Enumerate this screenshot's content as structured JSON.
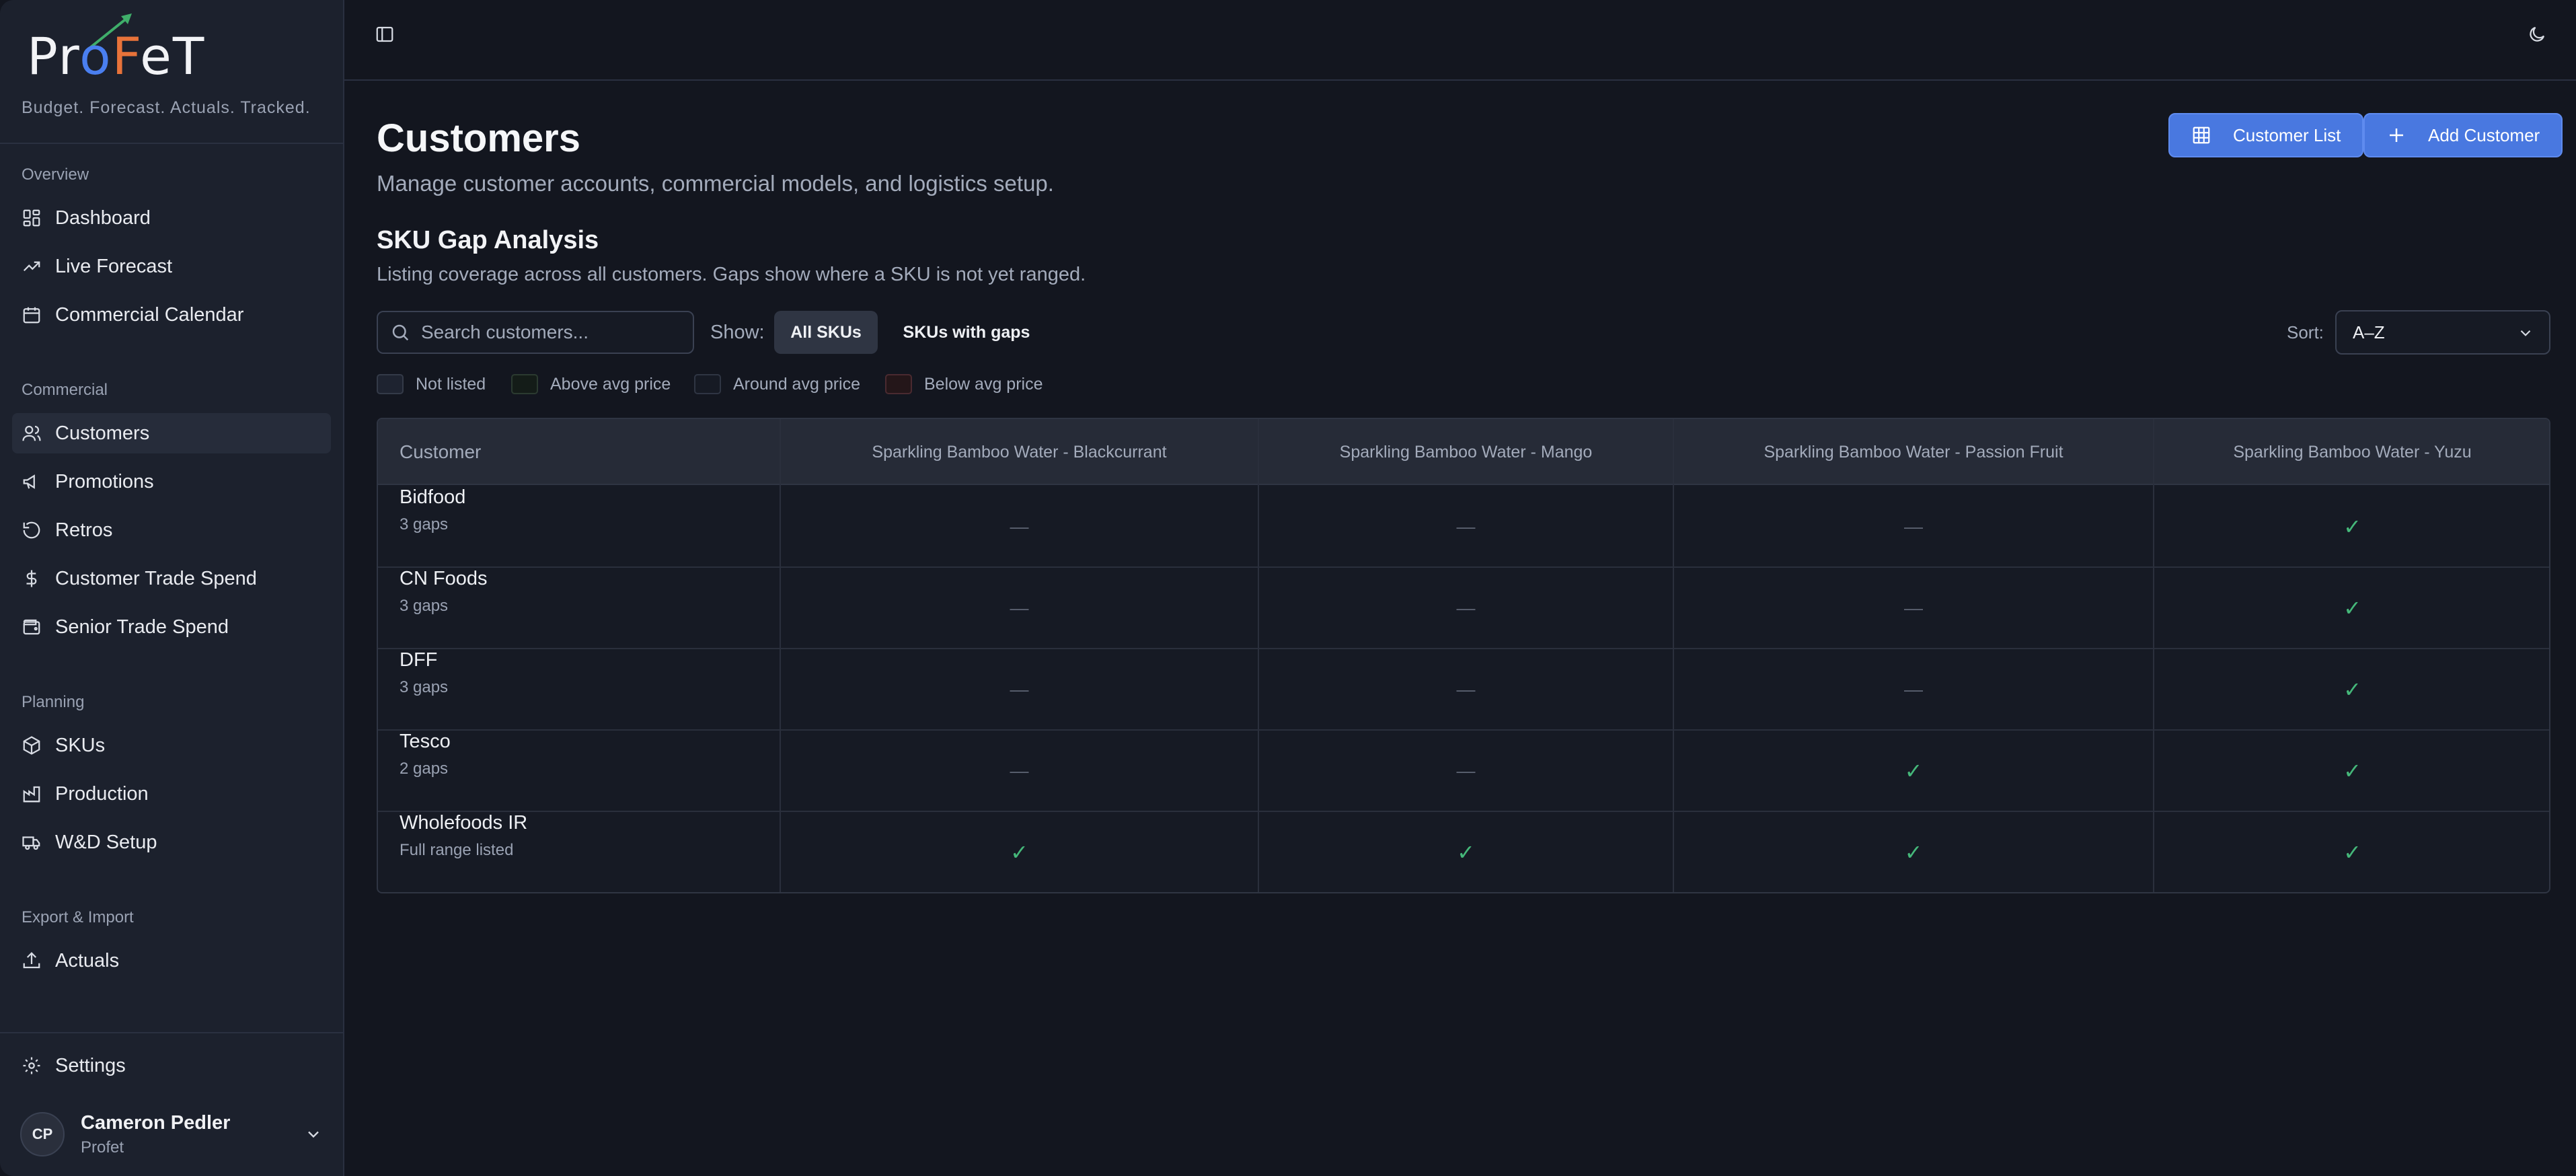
{
  "brand": {
    "logo_text": "ProFeT",
    "tagline": "Budget. Forecast. Actuals. Tracked."
  },
  "sidebar": {
    "groups": [
      {
        "label": "Overview",
        "items": [
          {
            "label": "Dashboard",
            "icon": "dashboard-icon"
          },
          {
            "label": "Live Forecast",
            "icon": "trending-up-icon"
          },
          {
            "label": "Commercial Calendar",
            "icon": "calendar-icon"
          }
        ]
      },
      {
        "label": "Commercial",
        "items": [
          {
            "label": "Customers",
            "icon": "users-icon",
            "active": true
          },
          {
            "label": "Promotions",
            "icon": "megaphone-icon"
          },
          {
            "label": "Retros",
            "icon": "rotate-icon"
          },
          {
            "label": "Customer Trade Spend",
            "icon": "dollar-icon"
          },
          {
            "label": "Senior Trade Spend",
            "icon": "wallet-icon"
          }
        ]
      },
      {
        "label": "Planning",
        "items": [
          {
            "label": "SKUs",
            "icon": "package-icon"
          },
          {
            "label": "Production",
            "icon": "factory-icon"
          },
          {
            "label": "W&D Setup",
            "icon": "truck-icon"
          }
        ]
      },
      {
        "label": "Export & Import",
        "items": [
          {
            "label": "Actuals",
            "icon": "upload-icon"
          }
        ]
      }
    ],
    "settings_label": "Settings",
    "user": {
      "initials": "CP",
      "name": "Cameron Pedler",
      "org": "Profet"
    }
  },
  "header": {
    "title": "Customers",
    "subtitle": "Manage customer accounts, commercial models, and logistics setup.",
    "customer_list_label": "Customer List",
    "add_customer_label": "Add Customer"
  },
  "gap_analysis": {
    "title": "SKU Gap Analysis",
    "subtitle": "Listing coverage across all customers. Gaps show where a SKU is not yet ranged.",
    "search_placeholder": "Search customers...",
    "show_label": "Show:",
    "filters": [
      "All SKUs",
      "SKUs with gaps"
    ],
    "active_filter": "All SKUs",
    "sort_label": "Sort:",
    "sort_value": "A–Z",
    "legend": [
      {
        "label": "Not listed",
        "color": "#1e2330",
        "border": "#343a48"
      },
      {
        "label": "Above avg price",
        "color": "#141c18",
        "border": "#2b3a30"
      },
      {
        "label": "Around avg price",
        "color": "#161a24",
        "border": "#2f3543"
      },
      {
        "label": "Below avg price",
        "color": "#241619",
        "border": "#4a2a30"
      }
    ],
    "columns": [
      "Customer",
      "Sparkling Bamboo Water - Blackcurrant",
      "Sparkling Bamboo Water - Mango",
      "Sparkling Bamboo Water - Passion Fruit",
      "Sparkling Bamboo Water - Yuzu"
    ],
    "rows": [
      {
        "name": "Bidfood",
        "gaps": "3 gaps",
        "cells": [
          "—",
          "—",
          "—",
          "✓"
        ]
      },
      {
        "name": "CN Foods",
        "gaps": "3 gaps",
        "cells": [
          "—",
          "—",
          "—",
          "✓"
        ]
      },
      {
        "name": "DFF",
        "gaps": "3 gaps",
        "cells": [
          "—",
          "—",
          "—",
          "✓"
        ]
      },
      {
        "name": "Tesco",
        "gaps": "2 gaps",
        "cells": [
          "—",
          "—",
          "✓",
          "✓"
        ]
      },
      {
        "name": "Wholefoods IR",
        "gaps": "Full range listed",
        "cells": [
          "✓",
          "✓",
          "✓",
          "✓"
        ]
      }
    ],
    "colors": {
      "listed": "#45b87a",
      "not_listed": "#5a6070",
      "accent": "#4978e0"
    }
  }
}
